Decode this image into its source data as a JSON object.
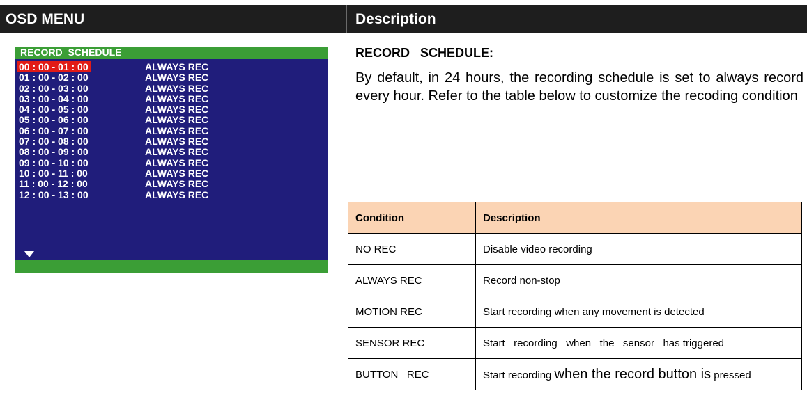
{
  "header": {
    "left": "OSD MENU",
    "right": "Description"
  },
  "osd": {
    "title": "RECORD  SCHEDULE",
    "rows": [
      {
        "time": "00 : 00 - 01 : 00",
        "mode": "ALWAYS REC"
      },
      {
        "time": "01 : 00 - 02 : 00",
        "mode": "ALWAYS REC"
      },
      {
        "time": "02 : 00 - 03 : 00",
        "mode": "ALWAYS REC"
      },
      {
        "time": "03 : 00 - 04 : 00",
        "mode": "ALWAYS REC"
      },
      {
        "time": "04 : 00 - 05 : 00",
        "mode": "ALWAYS REC"
      },
      {
        "time": "05 : 00 - 06 : 00",
        "mode": "ALWAYS REC"
      },
      {
        "time": "06 : 00 - 07 : 00",
        "mode": "ALWAYS REC"
      },
      {
        "time": "07 : 00 - 08 : 00",
        "mode": "ALWAYS REC"
      },
      {
        "time": "08 : 00 - 09 : 00",
        "mode": "ALWAYS REC"
      },
      {
        "time": "09 : 00 - 10 : 00",
        "mode": "ALWAYS REC"
      },
      {
        "time": "10 : 00 - 11 : 00",
        "mode": "ALWAYS REC"
      },
      {
        "time": "11 : 00 - 12 : 00",
        "mode": "ALWAYS REC"
      },
      {
        "time": "12 : 00 - 13 : 00",
        "mode": "ALWAYS REC"
      }
    ],
    "selected_index": 0,
    "scroll_icon": "down-triangle-icon",
    "colors": {
      "background": "#201d7b",
      "bar": "#3b9e36",
      "highlight": "#e21b16"
    }
  },
  "description": {
    "title": "RECORD   SCHEDULE:",
    "body": "By default, in 24 hours, the recording schedule is set to always record every hour. Refer to the table below to customize the recoding condition"
  },
  "table": {
    "headers": [
      "Condition",
      "Description"
    ],
    "rows": [
      {
        "condition": "NO REC",
        "description": "Disable video recording"
      },
      {
        "condition": "ALWAYS REC",
        "description": "Record non-stop"
      },
      {
        "condition": "MOTION REC",
        "description": "Start recording when any movement is detected"
      },
      {
        "condition": "SENSOR REC",
        "description": "Start   recording   when   the   sensor   has triggered"
      },
      {
        "condition": "BUTTON   REC",
        "description_a": "Start recording ",
        "description_b": "when the record button is",
        "description_c": " pressed"
      }
    ],
    "header_color": "#fbd4b4"
  }
}
